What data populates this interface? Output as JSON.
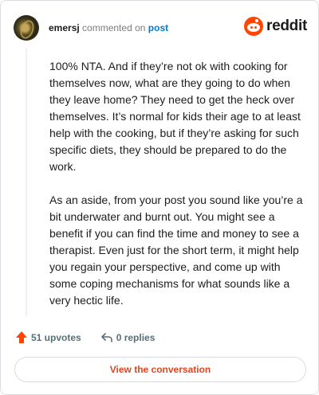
{
  "header": {
    "username": "emersj",
    "verb": "commented on",
    "post_link": "post",
    "brand": "reddit"
  },
  "comment": {
    "paragraphs": [
      "100% NTA. And if they’re not ok with cooking for themselves now, what are they going to do when they leave home? They need to get the heck over themselves. It’s normal for kids their age to at least help with the cooking, but if they’re asking for such specific diets, they should be prepared to do the work.",
      "As an aside, from your post you sound like you’re a bit underwater and burnt out. You might see a benefit if you can find the time and money to see a therapist. Even just for the short term, it might help you regain your perspective, and come up with some coping mechanisms for what sounds like a very hectic life."
    ]
  },
  "actions": {
    "upvotes": "51 upvotes",
    "replies": "0 replies"
  },
  "footer": {
    "button": "View the conversation"
  },
  "colors": {
    "accent": "#ff4500",
    "link": "#0079d3",
    "button_text": "#e0461f"
  },
  "icons": {
    "avatar": "user-avatar",
    "brand": "reddit-logo-icon",
    "upvote": "upvote-arrow-icon",
    "reply": "reply-arrow-icon"
  }
}
